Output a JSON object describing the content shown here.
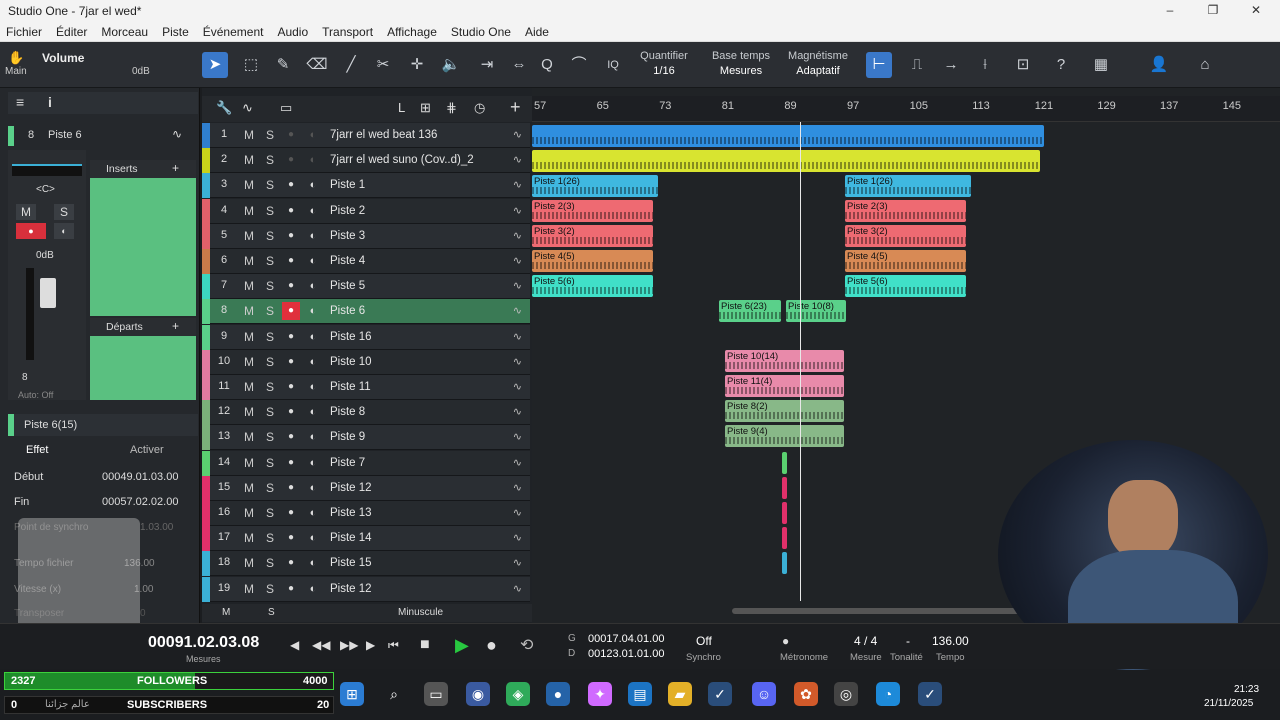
{
  "window": {
    "title": "Studio One - 7jar el wed*",
    "min": "–",
    "max": "❐",
    "close": "✕"
  },
  "menu": [
    "Fichier",
    "Éditer",
    "Morceau",
    "Piste",
    "Événement",
    "Audio",
    "Transport",
    "Affichage",
    "Studio One",
    "Aide"
  ],
  "toolbar": {
    "volume_label": "Volume",
    "main_label": "Main",
    "volume_value": "0dB",
    "quantize_label": "Quantifier",
    "quantize_value": "1/16",
    "timebase_label": "Base temps",
    "timebase_value": "Mesures",
    "snap_label": "Magnétisme",
    "snap_value": "Adaptatif",
    "iq_label": "IQ"
  },
  "inspector": {
    "track_num": "8",
    "track_name": "Piste 6",
    "pan": "<C>",
    "inserts_label": "Inserts",
    "sends_label": "Départs",
    "mute": "M",
    "solo": "S",
    "fader_db": "0dB",
    "channel_num": "8",
    "auto_label": "Auto: Off",
    "event_name": "Piste 6(15)",
    "effect_label": "Effet",
    "activate_label": "Activer",
    "start_label": "Début",
    "start_value": "00049.01.03.00",
    "end_label": "Fin",
    "end_value": "00057.02.02.00",
    "sync_label": "Point de synchro",
    "sync_value": "1.03.00",
    "tempo_file_label": "Tempo fichier",
    "tempo_file_value": "136.00",
    "speed_label": "Vitesse (x)",
    "speed_value": "1.00",
    "transpose_label": "Transposer",
    "transpose_value": "0"
  },
  "tracklist": {
    "footer_m": "M",
    "footer_s": "S",
    "footer_size": "Minuscule",
    "tracks": [
      {
        "num": "1",
        "name": "7jarr el wed beat 136",
        "color": "#2f7fd0"
      },
      {
        "num": "2",
        "name": "7jarr el wed suno (Cov..d)_2",
        "color": "#c8d21a"
      },
      {
        "num": "3",
        "name": "Piste 1",
        "color": "#3bb0d6"
      },
      {
        "num": "4",
        "name": "Piste 2",
        "color": "#e0606a"
      },
      {
        "num": "5",
        "name": "Piste 3",
        "color": "#e0606a"
      },
      {
        "num": "6",
        "name": "Piste 4",
        "color": "#c87a4a"
      },
      {
        "num": "7",
        "name": "Piste 5",
        "color": "#3cd6c0"
      },
      {
        "num": "8",
        "name": "Piste 6",
        "color": "#5ad08a"
      },
      {
        "num": "9",
        "name": "Piste 16",
        "color": "#5ad08a"
      },
      {
        "num": "10",
        "name": "Piste 10",
        "color": "#e07aa0"
      },
      {
        "num": "11",
        "name": "Piste 11",
        "color": "#e07aa0"
      },
      {
        "num": "12",
        "name": "Piste 8",
        "color": "#7ab07a"
      },
      {
        "num": "13",
        "name": "Piste 9",
        "color": "#7ab07a"
      },
      {
        "num": "14",
        "name": "Piste 7",
        "color": "#5ad070"
      },
      {
        "num": "15",
        "name": "Piste 12",
        "color": "#e0306a"
      },
      {
        "num": "16",
        "name": "Piste 13",
        "color": "#e0306a"
      },
      {
        "num": "17",
        "name": "Piste 14",
        "color": "#e0306a"
      },
      {
        "num": "18",
        "name": "Piste 15",
        "color": "#3bb0d6"
      },
      {
        "num": "19",
        "name": "Piste 12",
        "color": "#3bb0d6"
      }
    ]
  },
  "ruler": [
    "57",
    "65",
    "73",
    "81",
    "89",
    "97",
    "105",
    "113",
    "121",
    "129",
    "137",
    "145"
  ],
  "clips": [
    {
      "label": "",
      "color": "#2f8fe0"
    },
    {
      "label": "",
      "color": "#d8e430"
    },
    {
      "label": "Piste 1(26)",
      "color": "#3fb8e0"
    },
    {
      "label": "Piste 2(3)",
      "color": "#ee6a72"
    },
    {
      "label": "Piste 3(2)",
      "color": "#ee6a72"
    },
    {
      "label": "Piste 4(5)",
      "color": "#d88a55"
    },
    {
      "label": "Piste 5(6)",
      "color": "#40e0c8"
    },
    {
      "label": "Piste 1(26)",
      "color": "#3fb8e0"
    },
    {
      "label": "Piste 2(3)",
      "color": "#ee6a72"
    },
    {
      "label": "Piste 3(2)",
      "color": "#ee6a72"
    },
    {
      "label": "Piste 4(5)",
      "color": "#d88a55"
    },
    {
      "label": "Piste 5(6)",
      "color": "#40e0c8"
    },
    {
      "label": "Piste 6(23)",
      "color": "#5ad08a"
    },
    {
      "label": "Piste 10(8)",
      "color": "#5ad08a"
    },
    {
      "label": "Piste 10(14)",
      "color": "#e88aaa"
    },
    {
      "label": "Piste 11(4)",
      "color": "#e88aaa"
    },
    {
      "label": "Piste 8(2)",
      "color": "#88b888"
    },
    {
      "label": "Piste 9(4)",
      "color": "#88b888"
    }
  ],
  "transport": {
    "time": "00091.02.03.08",
    "time_unit": "Mesures",
    "loop_start_label": "G",
    "loop_start": "00017.04.01.00",
    "loop_end_label": "D",
    "loop_end": "00123.01.01.00",
    "sync_value": "Off",
    "sync_label": "Synchro",
    "metronome_label": "Métronome",
    "signature_value": "4 / 4",
    "signature_label": "Mesure",
    "key_value": "-",
    "key_label": "Tonalité",
    "tempo_value": "136.00",
    "tempo_label": "Tempo"
  },
  "stream": {
    "followers_count": "2327",
    "followers_label": "FOLLOWERS",
    "followers_goal": "4000",
    "subs_count": "0",
    "subs_name": "عالم جزائنا",
    "subs_label": "SUBSCRIBERS",
    "subs_goal": "20"
  },
  "clock": {
    "time": "21:23",
    "date": "21/11/2025"
  }
}
